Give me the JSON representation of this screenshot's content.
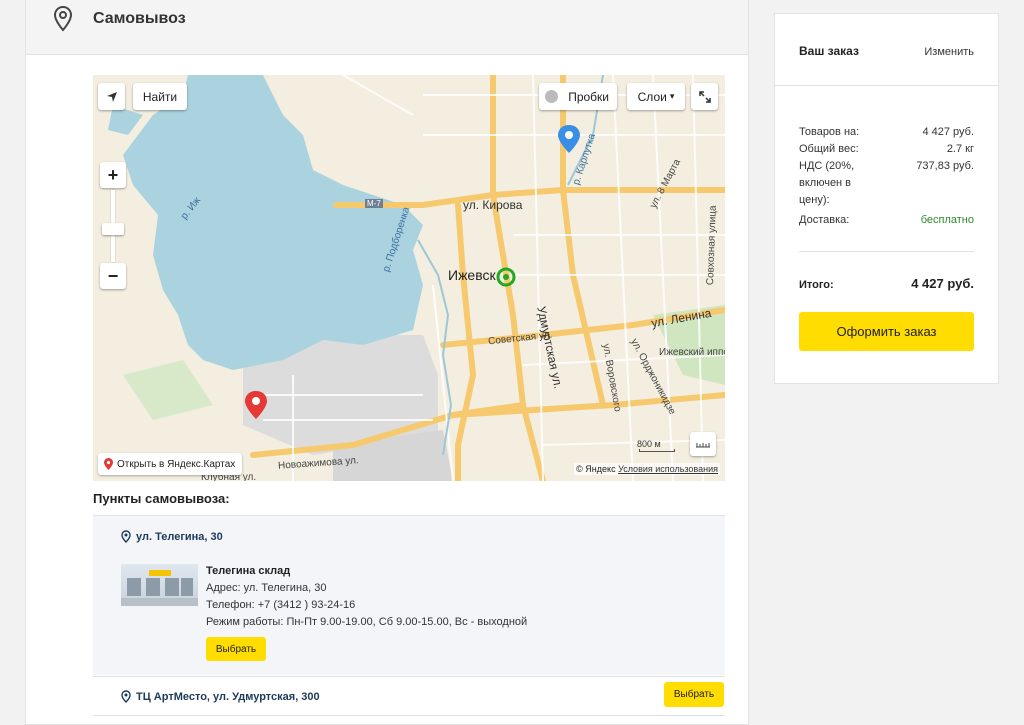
{
  "section": {
    "title": "Самовывоз",
    "icon": "map-pin-icon"
  },
  "map": {
    "find_label": "Найти",
    "traffic_label": "Пробки",
    "layers_label": "Слои",
    "zoom_in": "+",
    "zoom_out": "−",
    "open_label": "Открыть в Яндекс.Картах",
    "scale_label": "800 м",
    "copyright": "© Яндекс",
    "terms": "Условия использования",
    "labels": {
      "street_kirova": "ул. Кирова",
      "street_lenina": "ул. Ленина",
      "street_sovetskaya": "Советская ул.",
      "street_udmurtskaya": "Удмуртская ул.",
      "street_vorovskogo": "ул. Воровского",
      "street_ordzhonikidze": "ул. Орджоникидзе",
      "street_8marta": "ул. 8 Марта",
      "street_sovkhoznaya": "Совхозная улица",
      "street_novoazhimova": "Новоажимова ул.",
      "street_klubnaya": "Клубная ул.",
      "river_izh": "р. Иж",
      "river_podborenka": "р. Подборенка",
      "river_karlutka": "р. Карлутка",
      "city": "Ижевск",
      "park": "Ижевский иппо",
      "road_m7": "M-7"
    }
  },
  "pickup": {
    "heading": "Пункты самовывоза:",
    "points": [
      {
        "address": "ул. Телегина, 30",
        "name": "Телегина склад",
        "addr_line": "Адрес: ул. Телегина, 30",
        "phone_line": "Телефон: +7 (3412 ) 93-24-16",
        "hours_line": "Режим работы: Пн-Пт 9.00-19.00, Сб 9.00-15.00, Вс - выходной",
        "select_label": "Выбрать"
      },
      {
        "address": "ТЦ АртМесто, ул. Удмуртская, 300",
        "select_label": "Выбрать"
      }
    ]
  },
  "order": {
    "title": "Ваш заказ",
    "edit_label": "Изменить",
    "rows": [
      {
        "key": "Товаров на:",
        "value": "4 427 руб."
      },
      {
        "key": "Общий вес:",
        "value": "2.7 кг"
      },
      {
        "key": "НДС (20%, включен в цену):",
        "value": "737,83 руб."
      },
      {
        "key": "Доставка:",
        "value": "бесплатно"
      }
    ],
    "total_label": "Итого:",
    "total_value": "4 427 руб.",
    "checkout_label": "Оформить заказ"
  },
  "colors": {
    "accent": "#ffdd00",
    "free_shipping": "#2a8a2a",
    "link_dark": "#1e3a5a"
  }
}
